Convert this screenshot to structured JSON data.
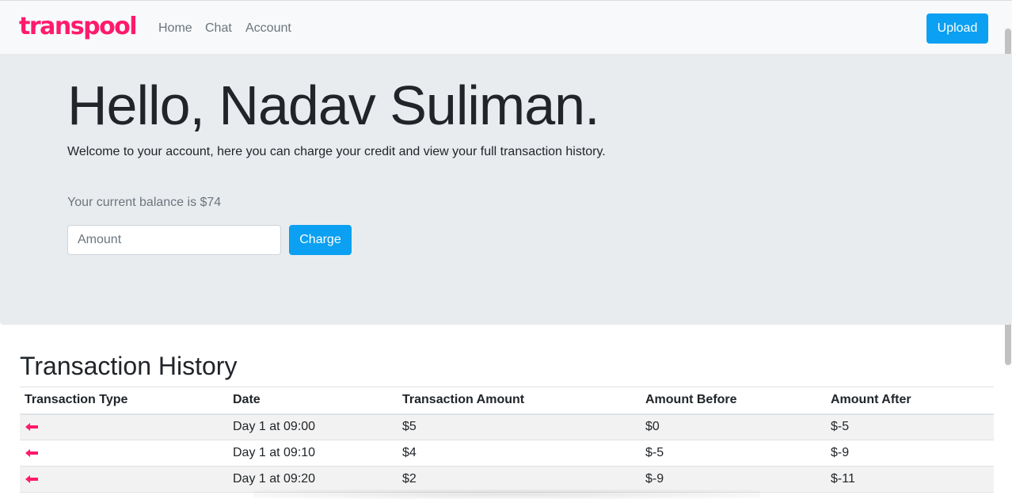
{
  "navbar": {
    "logo_text": "transpool",
    "links": [
      "Home",
      "Chat",
      "Account"
    ],
    "upload_label": "Upload"
  },
  "jumbotron": {
    "greeting": "Hello, Nadav Suliman.",
    "lead": "Welcome to your account, here you can charge your credit and view your full transaction history.",
    "balance_text": "Your current balance is $74",
    "amount_placeholder": "Amount",
    "charge_label": "Charge"
  },
  "transactions": {
    "title": "Transaction History",
    "headers": [
      "Transaction Type",
      "Date",
      "Transaction Amount",
      "Amount Before",
      "Amount After"
    ],
    "rows": [
      {
        "type_icon": "left-arrow-icon",
        "date": "Day 1 at 09:00",
        "amount": "$5",
        "before": "$0",
        "after": "$-5"
      },
      {
        "type_icon": "left-arrow-icon",
        "date": "Day 1 at 09:10",
        "amount": "$4",
        "before": "$-5",
        "after": "$-9"
      },
      {
        "type_icon": "left-arrow-icon",
        "date": "Day 1 at 09:20",
        "amount": "$2",
        "before": "$-9",
        "after": "$-11"
      }
    ]
  },
  "colors": {
    "brand_pink": "#ff1a6c",
    "brand_blue": "#2b8cf0",
    "primary_button": "#0ba0f2",
    "jumbotron_bg": "#e9ecef"
  }
}
